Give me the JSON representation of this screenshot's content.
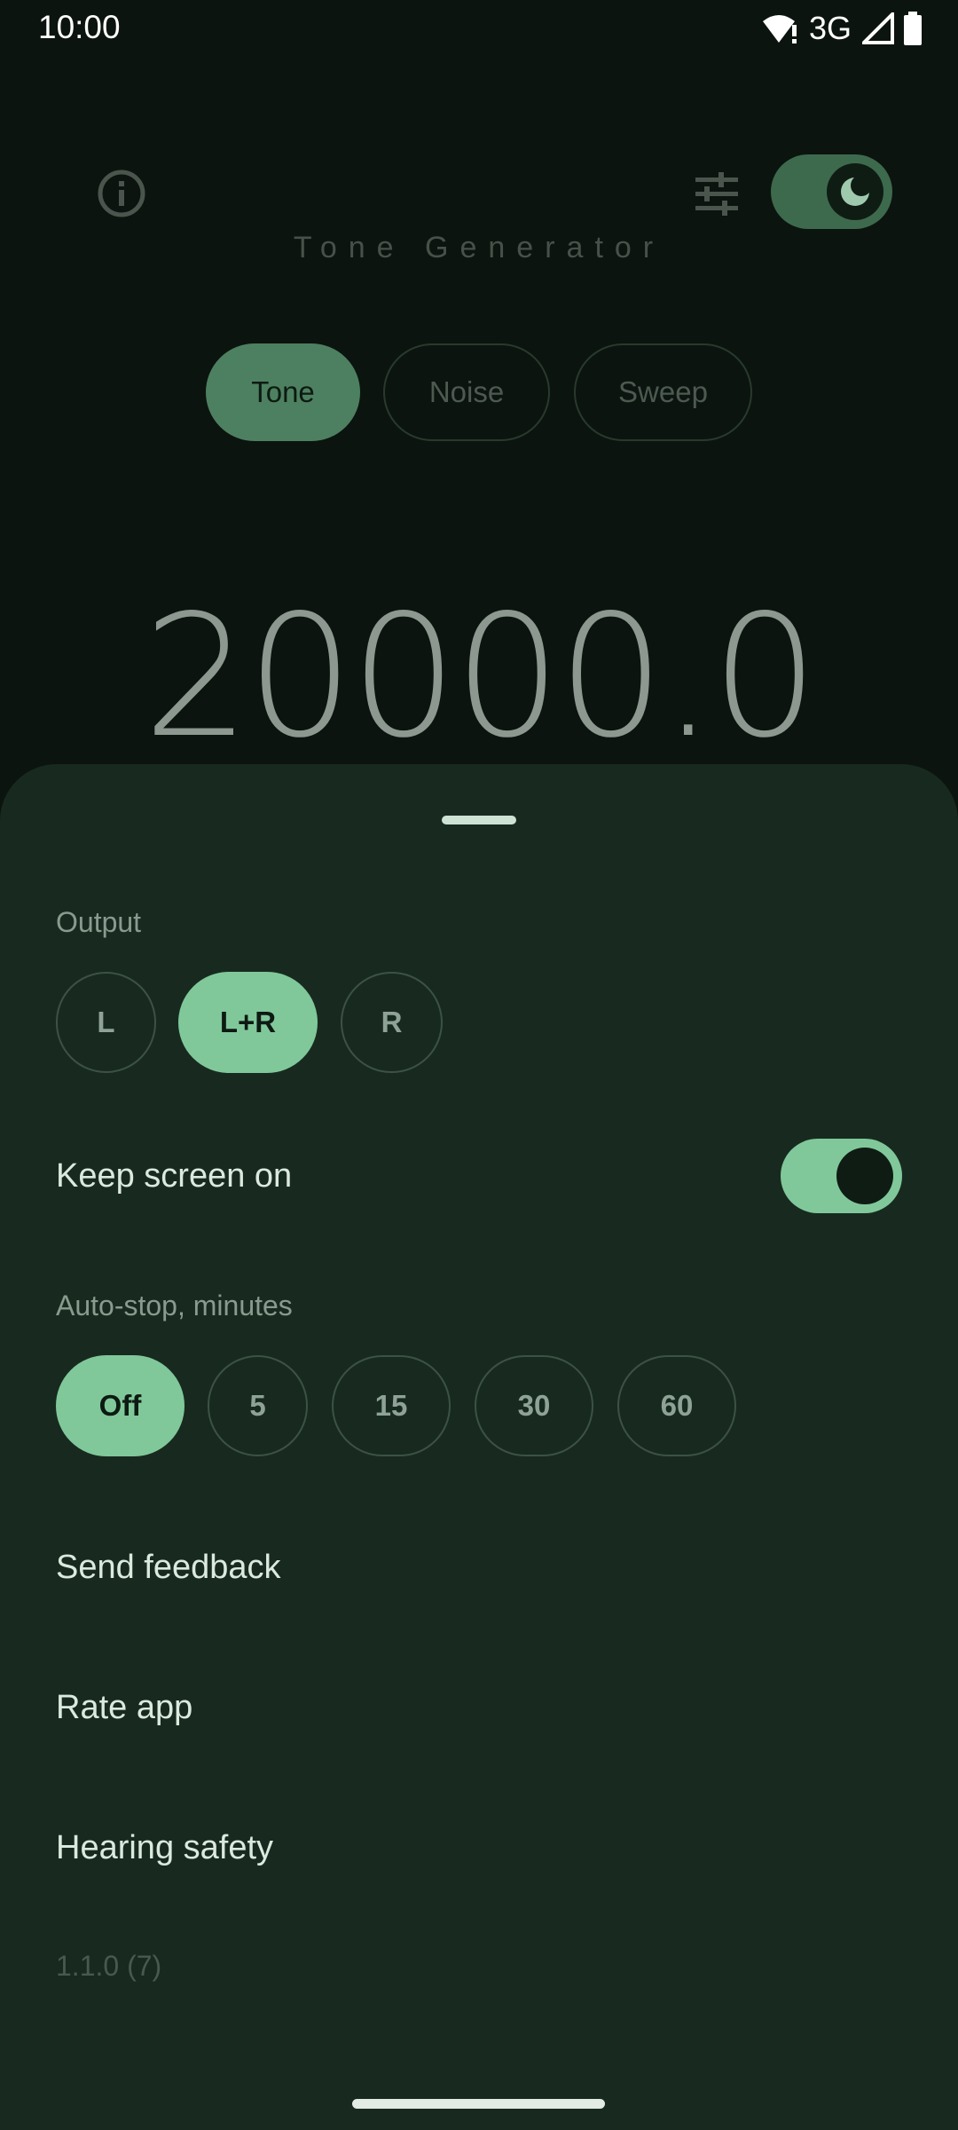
{
  "status_bar": {
    "time": "10:00",
    "network": "3G",
    "icons": [
      "wifi-alert-icon",
      "signal-icon",
      "battery-icon"
    ]
  },
  "app": {
    "title": "Tone Generator",
    "info_icon": "info-icon",
    "tune_icon": "tune-icon",
    "theme_toggle": {
      "icon": "moon-icon",
      "on": true
    },
    "modes": [
      {
        "label": "Tone",
        "selected": true
      },
      {
        "label": "Noise",
        "selected": false
      },
      {
        "label": "Sweep",
        "selected": false
      }
    ],
    "frequency": "20000.0"
  },
  "sheet": {
    "output_label": "Output",
    "output_options": [
      {
        "label": "L",
        "selected": false
      },
      {
        "label": "L+R",
        "selected": true
      },
      {
        "label": "R",
        "selected": false
      }
    ],
    "keep_screen_on": {
      "label": "Keep screen on",
      "on": true
    },
    "autostop_label": "Auto-stop, minutes",
    "autostop_options": [
      {
        "label": "Off",
        "selected": true
      },
      {
        "label": "5",
        "selected": false
      },
      {
        "label": "15",
        "selected": false
      },
      {
        "label": "30",
        "selected": false
      },
      {
        "label": "60",
        "selected": false
      }
    ],
    "send_feedback": "Send feedback",
    "rate_app": "Rate app",
    "hearing_safety": "Hearing safety",
    "version": "1.1.0 (7)"
  },
  "colors": {
    "accent": "#80c89a",
    "sheet_bg": "#182a1f",
    "page_bg": "#0c140f"
  }
}
